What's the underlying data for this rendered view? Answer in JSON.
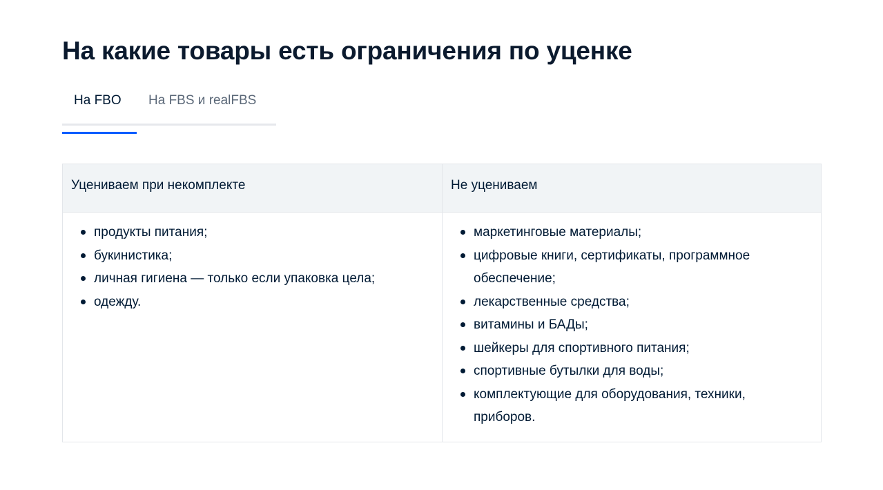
{
  "page": {
    "title": "На какие товары есть ограничения по уценке"
  },
  "tabs": [
    {
      "label": "На FBO",
      "active": true
    },
    {
      "label": "На FBS и realFBS",
      "active": false
    }
  ],
  "table": {
    "headers": [
      "Уцениваем при некомплекте",
      "Не уцениваем"
    ],
    "columns": [
      {
        "items": [
          "продукты питания;",
          "букинистика;",
          "личная гигиена — только если упаковка цела;",
          "одежду."
        ]
      },
      {
        "items": [
          "маркетинговые материалы;",
          "цифровые книги, сертификаты, программное обеспечение;",
          "лекарственные средства;",
          "витамины и БАДы;",
          "шейкеры для спортивного питания;",
          "спортивные бутылки для воды;",
          "комплектующие для оборудования, техники, приборов."
        ]
      }
    ]
  },
  "colors": {
    "text": "#001a34",
    "tab_active_indicator": "#005bff",
    "header_background": "#f1f4f6",
    "border": "#e3e6ea"
  }
}
